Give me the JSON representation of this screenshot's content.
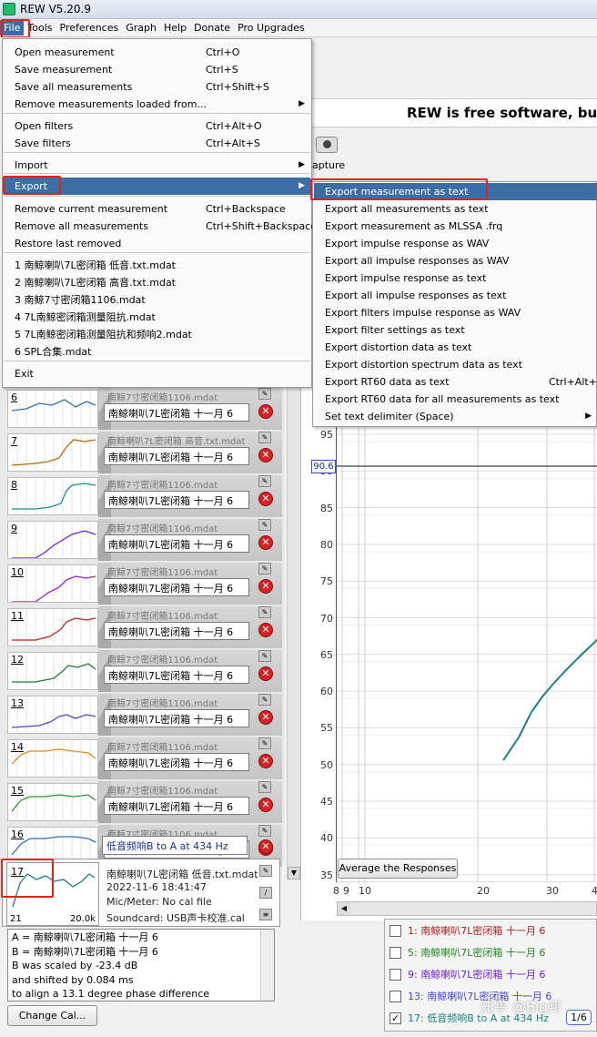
{
  "window": {
    "title": "REW V5.20.9"
  },
  "menubar": [
    "File",
    "Tools",
    "Preferences",
    "Graph",
    "Help",
    "Donate",
    "Pro Upgrades"
  ],
  "banner": "REW is free software, but i",
  "toolbar": {
    "capture_label": "apture"
  },
  "file_menu": {
    "items": [
      {
        "label": "Open measurement",
        "shortcut": "Ctrl+O"
      },
      {
        "label": "Save measurement",
        "shortcut": "Ctrl+S"
      },
      {
        "label": "Save all measurements",
        "shortcut": "Ctrl+Shift+S"
      },
      {
        "label": "Remove measurements loaded from...",
        "shortcut": ""
      },
      {
        "label": "Open filters",
        "shortcut": "Ctrl+Alt+O"
      },
      {
        "label": "Save filters",
        "shortcut": "Ctrl+Alt+S"
      },
      {
        "label": "Import",
        "shortcut": ""
      },
      {
        "label": "Export",
        "shortcut": ""
      },
      {
        "label": "Remove current measurement",
        "shortcut": "Ctrl+Backspace"
      },
      {
        "label": "Remove all measurements",
        "shortcut": "Ctrl+Shift+Backspace"
      },
      {
        "label": "Restore last removed",
        "shortcut": ""
      },
      {
        "label": "1 南鲸喇叭7L密闭箱 低音.txt.mdat",
        "shortcut": ""
      },
      {
        "label": "2 南鲸喇叭7L密闭箱 高音.txt.mdat",
        "shortcut": ""
      },
      {
        "label": "3 南鲸7寸密闭箱1106.mdat",
        "shortcut": ""
      },
      {
        "label": "4 7L南鲸密闭箱测量阻抗.mdat",
        "shortcut": ""
      },
      {
        "label": "5 7L南鲸密闭箱测量阻抗和频响2.mdat",
        "shortcut": ""
      },
      {
        "label": "6 SPL合集.mdat",
        "shortcut": ""
      },
      {
        "label": "Exit",
        "shortcut": ""
      }
    ]
  },
  "export_menu": {
    "items": [
      {
        "label": "Export measurement as text",
        "shortcut": ""
      },
      {
        "label": "Export all measurements as text",
        "shortcut": ""
      },
      {
        "label": "Export measurement as MLSSA .frq",
        "shortcut": ""
      },
      {
        "label": "Export impulse response as WAV",
        "shortcut": ""
      },
      {
        "label": "Export all impulse responses as WAV",
        "shortcut": ""
      },
      {
        "label": "Export impulse response as text",
        "shortcut": ""
      },
      {
        "label": "Export all impulse responses as text",
        "shortcut": ""
      },
      {
        "label": "Export filters impulse response as WAV",
        "shortcut": ""
      },
      {
        "label": "Export filter settings as text",
        "shortcut": ""
      },
      {
        "label": "Export distortion data as text",
        "shortcut": ""
      },
      {
        "label": "Export distortion spectrum data as text",
        "shortcut": ""
      },
      {
        "label": "Export RT60 data as text",
        "shortcut": "Ctrl+Alt+R"
      },
      {
        "label": "Export RT60 data for all measurements as text",
        "shortcut": ""
      },
      {
        "label": "Set text delimiter (Space)",
        "shortcut": ""
      }
    ]
  },
  "measurements": [
    {
      "num": "6",
      "name": "南鲸喇叭7L密闭箱 十一月 6",
      "ghost": "南鲸7寸密闭箱1106.mdat",
      "color": "#2a6fbf"
    },
    {
      "num": "7",
      "name": "南鲸喇叭7L密闭箱 十一月 6",
      "ghost": "南鲸喇叭7L密闭箱 高音.txt.mdat",
      "color": "#b06a10"
    },
    {
      "num": "8",
      "name": "南鲸喇叭7L密闭箱 十一月 6",
      "ghost": "南鲸7寸密闭箱1106.mdat",
      "color": "#1c8c8c"
    },
    {
      "num": "9",
      "name": "南鲸喇叭7L密闭箱 十一月 6",
      "ghost": "南鲸7寸密闭箱1106.mdat",
      "color": "#6b1ee0"
    },
    {
      "num": "10",
      "name": "南鲸喇叭7L密闭箱 十一月 6",
      "ghost": "南鲸7寸密闭箱1106.mdat",
      "color": "#9a22c9"
    },
    {
      "num": "11",
      "name": "南鲸喇叭7L密闭箱 十一月 6",
      "ghost": "南鲸7寸密闭箱1106.mdat",
      "color": "#c01f1f"
    },
    {
      "num": "12",
      "name": "南鲸喇叭7L密闭箱 十一月 6",
      "ghost": "南鲸7寸密闭箱1106.mdat",
      "color": "#1f7a3a"
    },
    {
      "num": "13",
      "name": "南鲸喇叭7L密闭箱 十一月 6",
      "ghost": "南鲸7寸密闭箱1106.mdat",
      "color": "#4848c8"
    },
    {
      "num": "14",
      "name": "南鲸喇叭7L密闭箱 十一月 6",
      "ghost": "南鲸7寸密闭箱1106.mdat",
      "color": "#e08a1a"
    },
    {
      "num": "15",
      "name": "南鲸喇叭7L密闭箱 十一月 6",
      "ghost": "南鲸7寸密闭箱1106.mdat",
      "color": "#2a9a2a"
    },
    {
      "num": "16",
      "name": "南鲸喇叭7L密闭箱 十一月 6",
      "ghost": "南鲸7寸密闭箱1106.mdat",
      "color": "#2a6fbf"
    }
  ],
  "selected": {
    "num": "17",
    "name": "低音频响B to A at 434 Hz",
    "file": "南鲸喇叭7L密闭箱 低音.txt.mdat",
    "date": "2022-11-6 18:41:47",
    "mic": "Mic/Meter: No cal file",
    "soundcard": "Soundcard: USB声卡校准.cal",
    "range_lo": "21",
    "range_hi": "20.0k"
  },
  "log_lines": [
    "A = 南鲸喇叭7L密闭箱 十一月 6",
    "B = 南鲸喇叭7L密闭箱 十一月 6",
    "B was scaled by -23.4 dB",
    "and shifted by 0.084 ms",
    "to align a 13.1 degree phase difference"
  ],
  "buttons": {
    "change_cal": "Change Cal...",
    "average": "Average the Responses"
  },
  "graph": {
    "y_ticks": [
      "95",
      "90",
      "85",
      "80",
      "75",
      "70",
      "65",
      "60",
      "55",
      "50",
      "45",
      "40",
      "35"
    ],
    "x_ticks": [
      "8",
      "9",
      "10",
      "20",
      "30",
      "4"
    ],
    "cursor_value": "90.6"
  },
  "legend": [
    {
      "label": "1: 南鲸喇叭7L密闭箱 十一月 6",
      "color": "#b02020",
      "checked": false
    },
    {
      "label": "5: 南鲸喇叭7L密闭箱 十一月 6",
      "color": "#1f8a1f",
      "checked": false
    },
    {
      "label": "9: 南鲸喇叭7L密闭箱 十一月 6",
      "color": "#6b1ee0",
      "checked": false
    },
    {
      "label": "13: 南鲸喇叭7L密闭箱 十一月 6",
      "color": "#4848c8",
      "checked": false
    },
    {
      "label": "17: 低音频响B to A at 434 Hz",
      "color": "#1c8080",
      "checked": true
    }
  ],
  "fraction_box": "1/6",
  "watermark": "知乎 @Big邦"
}
